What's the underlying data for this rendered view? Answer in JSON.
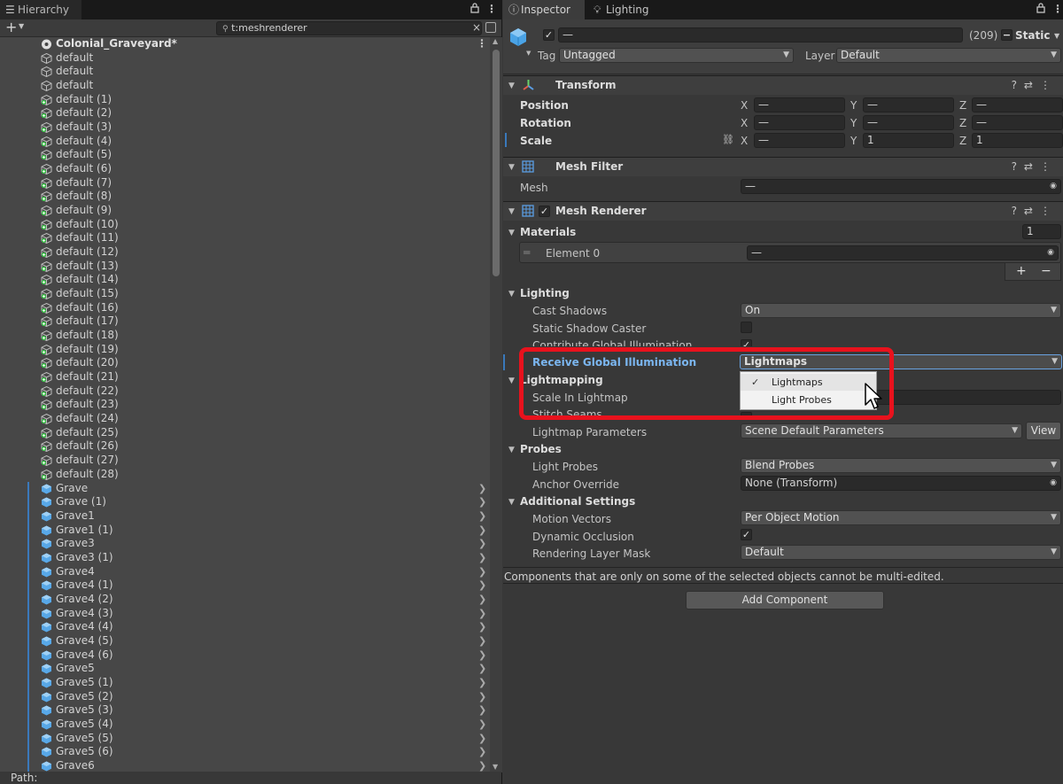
{
  "hierarchy": {
    "tab_label": "Hierarchy",
    "search_value": "t:meshrenderer",
    "path_label": "Path:",
    "scene_name": "Colonial_Graveyard*",
    "items": [
      {
        "label": "default",
        "icon": "gameobject-outline-icon",
        "prefab": false
      },
      {
        "label": "default",
        "icon": "gameobject-outline-icon",
        "prefab": false
      },
      {
        "label": "default",
        "icon": "gameobject-outline-icon",
        "prefab": false
      },
      {
        "label": "default (1)",
        "icon": "gameobject-green-icon",
        "prefab": false
      },
      {
        "label": "default (2)",
        "icon": "gameobject-green-icon",
        "prefab": false
      },
      {
        "label": "default (3)",
        "icon": "gameobject-green-icon",
        "prefab": false
      },
      {
        "label": "default (4)",
        "icon": "gameobject-green-icon",
        "prefab": false
      },
      {
        "label": "default (5)",
        "icon": "gameobject-green-icon",
        "prefab": false
      },
      {
        "label": "default (6)",
        "icon": "gameobject-green-icon",
        "prefab": false
      },
      {
        "label": "default (7)",
        "icon": "gameobject-green-icon",
        "prefab": false
      },
      {
        "label": "default (8)",
        "icon": "gameobject-green-icon",
        "prefab": false
      },
      {
        "label": "default (9)",
        "icon": "gameobject-green-icon",
        "prefab": false
      },
      {
        "label": "default (10)",
        "icon": "gameobject-green-icon",
        "prefab": false
      },
      {
        "label": "default (11)",
        "icon": "gameobject-green-icon",
        "prefab": false
      },
      {
        "label": "default (12)",
        "icon": "gameobject-green-icon",
        "prefab": false
      },
      {
        "label": "default (13)",
        "icon": "gameobject-green-icon",
        "prefab": false
      },
      {
        "label": "default (14)",
        "icon": "gameobject-green-icon",
        "prefab": false
      },
      {
        "label": "default (15)",
        "icon": "gameobject-green-icon",
        "prefab": false
      },
      {
        "label": "default (16)",
        "icon": "gameobject-green-icon",
        "prefab": false
      },
      {
        "label": "default (17)",
        "icon": "gameobject-green-icon",
        "prefab": false
      },
      {
        "label": "default (18)",
        "icon": "gameobject-green-icon",
        "prefab": false
      },
      {
        "label": "default (19)",
        "icon": "gameobject-green-icon",
        "prefab": false
      },
      {
        "label": "default (20)",
        "icon": "gameobject-green-icon",
        "prefab": false
      },
      {
        "label": "default (21)",
        "icon": "gameobject-green-icon",
        "prefab": false
      },
      {
        "label": "default (22)",
        "icon": "gameobject-green-icon",
        "prefab": false
      },
      {
        "label": "default (23)",
        "icon": "gameobject-green-icon",
        "prefab": false
      },
      {
        "label": "default (24)",
        "icon": "gameobject-green-icon",
        "prefab": false
      },
      {
        "label": "default (25)",
        "icon": "gameobject-green-icon",
        "prefab": false
      },
      {
        "label": "default (26)",
        "icon": "gameobject-green-icon",
        "prefab": false
      },
      {
        "label": "default (27)",
        "icon": "gameobject-green-icon",
        "prefab": false
      },
      {
        "label": "default (28)",
        "icon": "gameobject-green-icon",
        "prefab": false
      },
      {
        "label": "Grave",
        "icon": "prefab-icon",
        "prefab": true
      },
      {
        "label": "Grave (1)",
        "icon": "prefab-icon",
        "prefab": true
      },
      {
        "label": "Grave1",
        "icon": "prefab-icon",
        "prefab": true
      },
      {
        "label": "Grave1 (1)",
        "icon": "prefab-icon",
        "prefab": true
      },
      {
        "label": "Grave3",
        "icon": "prefab-icon",
        "prefab": true
      },
      {
        "label": "Grave3 (1)",
        "icon": "prefab-icon",
        "prefab": true
      },
      {
        "label": "Grave4",
        "icon": "prefab-icon",
        "prefab": true
      },
      {
        "label": "Grave4 (1)",
        "icon": "prefab-icon",
        "prefab": true
      },
      {
        "label": "Grave4 (2)",
        "icon": "prefab-icon",
        "prefab": true
      },
      {
        "label": "Grave4 (3)",
        "icon": "prefab-icon",
        "prefab": true
      },
      {
        "label": "Grave4 (4)",
        "icon": "prefab-icon",
        "prefab": true
      },
      {
        "label": "Grave4 (5)",
        "icon": "prefab-icon",
        "prefab": true
      },
      {
        "label": "Grave4 (6)",
        "icon": "prefab-icon",
        "prefab": true
      },
      {
        "label": "Grave5",
        "icon": "prefab-icon",
        "prefab": true
      },
      {
        "label": "Grave5 (1)",
        "icon": "prefab-icon",
        "prefab": true
      },
      {
        "label": "Grave5 (2)",
        "icon": "prefab-icon",
        "prefab": true
      },
      {
        "label": "Grave5 (3)",
        "icon": "prefab-icon",
        "prefab": true
      },
      {
        "label": "Grave5 (4)",
        "icon": "prefab-icon",
        "prefab": true
      },
      {
        "label": "Grave5 (5)",
        "icon": "prefab-icon",
        "prefab": true
      },
      {
        "label": "Grave5 (6)",
        "icon": "prefab-icon",
        "prefab": true
      },
      {
        "label": "Grave6",
        "icon": "prefab-icon",
        "prefab": true
      }
    ]
  },
  "inspector": {
    "tab_inspector": "Inspector",
    "tab_lighting": "Lighting",
    "object_name": "—",
    "count": "(209)",
    "static_label": "Static",
    "tag_label": "Tag",
    "tag_value": "Untagged",
    "layer_label": "Layer",
    "layer_value": "Default",
    "transform": {
      "title": "Transform",
      "position": "Position",
      "rotation": "Rotation",
      "scale": "Scale",
      "x": "X",
      "y": "Y",
      "z": "Z",
      "dash": "—",
      "scale_y": "1",
      "scale_z": "1"
    },
    "mesh_filter": {
      "title": "Mesh Filter",
      "mesh_label": "Mesh",
      "mesh_value": "—"
    },
    "mesh_renderer": {
      "title": "Mesh Renderer",
      "materials": "Materials",
      "materials_count": "1",
      "element0": "Element 0",
      "element0_value": "—",
      "plus": "+",
      "minus": "−",
      "lighting": "Lighting",
      "cast_shadows": "Cast Shadows",
      "cast_shadows_value": "On",
      "static_shadow_caster": "Static Shadow Caster",
      "contribute_gi": "Contribute Global Illumination",
      "receive_gi": "Receive Global Illumination",
      "receive_gi_value": "Lightmaps",
      "lightmapping": "Lightmapping",
      "scale_in_lightmap": "Scale In Lightmap",
      "stitch_seams": "Stitch Seams",
      "lightmap_params": "Lightmap Parameters",
      "lightmap_params_value": "Scene Default Parameters",
      "view": "View",
      "probes": "Probes",
      "light_probes": "Light Probes",
      "light_probes_value": "Blend Probes",
      "anchor_override": "Anchor Override",
      "anchor_override_value": "None (Transform)",
      "additional": "Additional Settings",
      "motion_vectors": "Motion Vectors",
      "motion_vectors_value": "Per Object Motion",
      "dynamic_occlusion": "Dynamic Occlusion",
      "rendering_layer_mask": "Rendering Layer Mask",
      "rendering_layer_mask_value": "Default"
    },
    "note": "Components that are only on some of the selected objects cannot be multi-edited.",
    "add_component": "Add Component",
    "popup": {
      "opt1": "Lightmaps",
      "opt2": "Light Probes",
      "check": "✓"
    }
  },
  "colors": {
    "highlight": "#e8121d",
    "prefab_blue": "#58a8e8",
    "green_badge": "#3ec14b",
    "label_blue": "#7bb6f0"
  }
}
